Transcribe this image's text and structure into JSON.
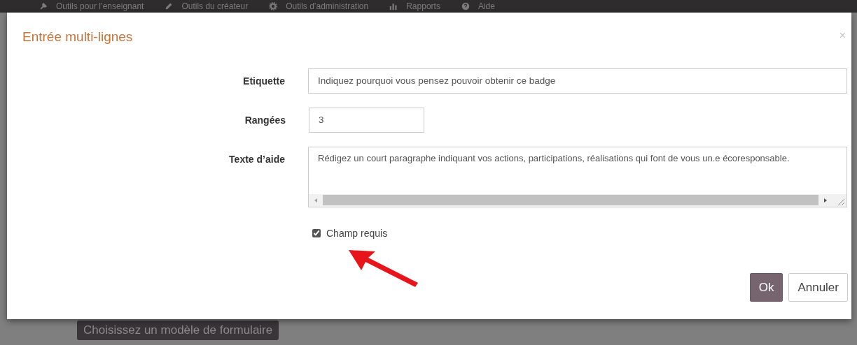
{
  "navbar": {
    "items": [
      {
        "label": "Outils pour l’enseignant"
      },
      {
        "label": "Outils du créateur"
      },
      {
        "label": "Outils d’administration"
      },
      {
        "label": "Rapports"
      },
      {
        "label": "Aide"
      }
    ]
  },
  "page": {
    "template_button": "Choisissez un modèle de formulaire"
  },
  "dialog": {
    "title": "Entrée multi-lignes",
    "close": "×",
    "fields": [
      {
        "kind": "text",
        "label": "Etiquette",
        "value": "Indiquez pourquoi vous pensez pouvoir obtenir ce badge"
      },
      {
        "kind": "number",
        "label": "Rangées",
        "value": "3"
      },
      {
        "kind": "textarea",
        "label": "Texte d’aide",
        "value": "Rédigez un court paragraphe indiquant vos actions, participations, réalisations qui font de vous un.e écoresponsable."
      }
    ],
    "checkbox": {
      "label": "Champ requis",
      "checked": true
    },
    "buttons": [
      {
        "kind": "primary",
        "label": "Ok"
      },
      {
        "kind": "secondary",
        "label": "Annuler"
      }
    ]
  }
}
